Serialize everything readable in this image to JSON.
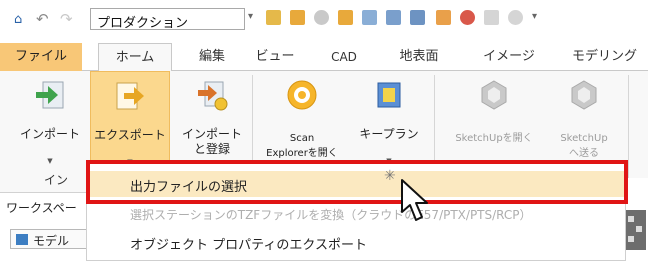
{
  "qat": {
    "combo_value": "プロダクション",
    "home_icon": "home-icon",
    "undo_icon": "undo-icon",
    "redo_icon": "redo-icon"
  },
  "tabs": [
    {
      "label": "ファイル"
    },
    {
      "label": "ホーム"
    },
    {
      "label": "編集"
    },
    {
      "label": "ビュー"
    },
    {
      "label": "CAD"
    },
    {
      "label": "地表面"
    },
    {
      "label": "イメージ"
    },
    {
      "label": "モデリング"
    }
  ],
  "ribbon": {
    "buttons": [
      {
        "label": "インポート",
        "icon": "import-icon"
      },
      {
        "label": "エクスポート",
        "icon": "export-icon"
      },
      {
        "label": "インポート\nと登録",
        "icon": "import-register-icon"
      },
      {
        "label": "Scan\nExplorerを開く",
        "icon": "scan-explorer-icon"
      },
      {
        "label": "キープラン",
        "icon": "key-plan-icon"
      },
      {
        "label": "SketchUpを開く",
        "icon": "sketchup-open-icon"
      },
      {
        "label": "SketchUp\nへ送る",
        "icon": "sketchup-send-icon"
      }
    ],
    "group_label": "イン"
  },
  "panel": {
    "workspace_label": "ワークスペー",
    "model_tab": "モデル"
  },
  "menu": {
    "items": [
      {
        "label": "出力ファイルの選択"
      },
      {
        "label": "選択ステーションのTZFファイルを変換（クラウドのE57/PTX/PTS/RCP）"
      },
      {
        "label": "オブジェクト プロパティのエクスポート"
      }
    ]
  },
  "colors": {
    "file_tab": "#f8c777",
    "highlight_button": "#fbd88e",
    "menu_highlight": "#fbe9c1",
    "callout_red": "#e01515"
  }
}
